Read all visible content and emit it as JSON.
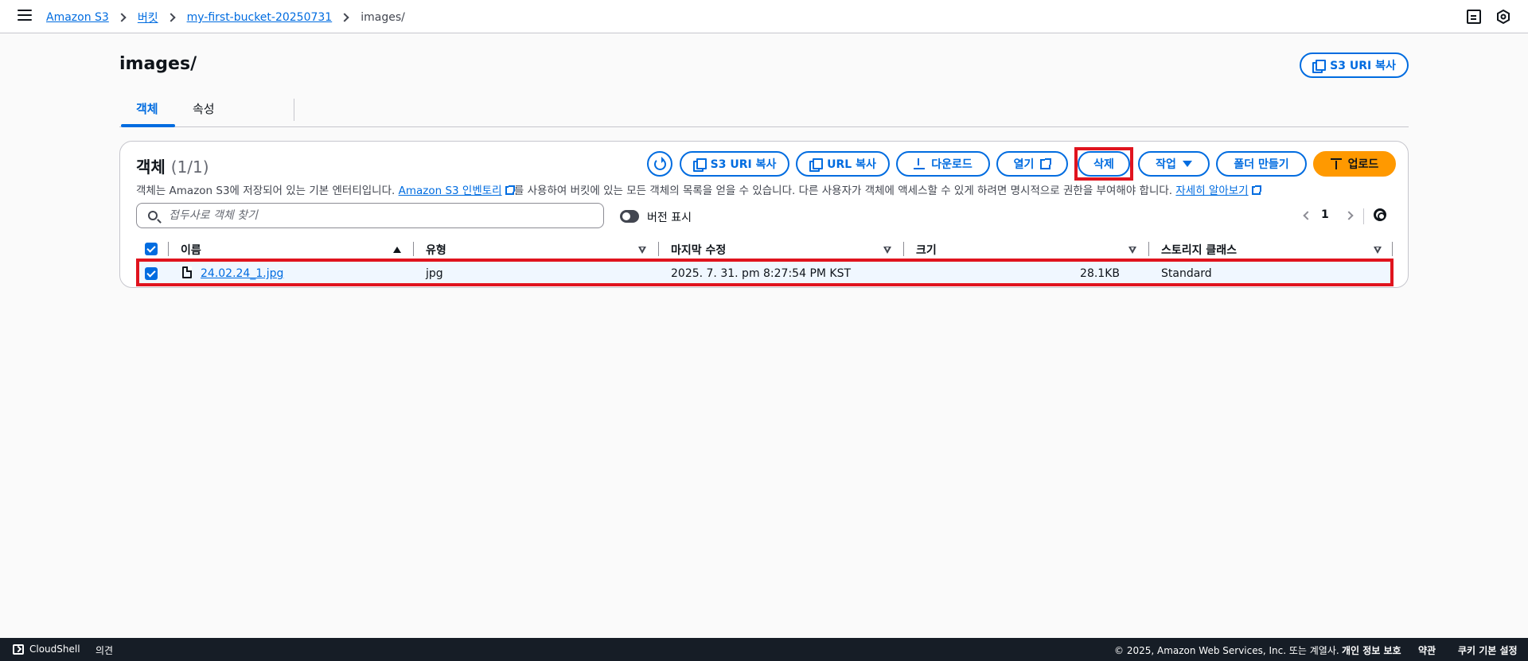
{
  "breadcrumb": {
    "items": [
      "Amazon S3",
      "버킷",
      "my-first-bucket-20250731"
    ],
    "current": "images/"
  },
  "header": {
    "title": "images/",
    "copy_s3_uri_label": "S3 URI 복사"
  },
  "tabs": [
    {
      "label": "객체",
      "active": true
    },
    {
      "label": "속성",
      "active": false
    }
  ],
  "objects_panel": {
    "title": "객체",
    "count": "(1/1)",
    "description_before": "객체는 Amazon S3에 저장되어 있는 기본 엔터티입니다. ",
    "inventory_link": "Amazon S3 인벤토리",
    "description_after": "를 사용하여 버킷에 있는 모든 객체의 목록을 얻을 수 있습니다. 다른 사용자가 객체에 액세스할 수 있게 하려면 명시적으로 권한을 부여해야 합니다. ",
    "learn_more_link": "자세히 알아보기",
    "actions": {
      "copy_s3_uri": "S3 URI 복사",
      "copy_url": "URL 복사",
      "download": "다운로드",
      "open": "열기",
      "delete": "삭제",
      "actions": "작업",
      "create_folder": "폴더 만들기",
      "upload": "업로드"
    },
    "search_placeholder": "접두사로 객체 찾기",
    "show_versions_label": "버전 표시",
    "page_number": "1",
    "columns": [
      "이름",
      "유형",
      "마지막 수정",
      "크기",
      "스토리지 클래스"
    ],
    "rows": [
      {
        "name": "24.02.24_1.jpg",
        "type": "jpg",
        "last_modified": "2025. 7. 31. pm 8:27:54 PM KST",
        "size": "28.1KB",
        "storage_class": "Standard"
      }
    ]
  },
  "footer": {
    "cloudshell": "CloudShell",
    "feedback": "의견",
    "copyright": "© 2025, Amazon Web Services, Inc. 또는 계열사.",
    "privacy": "개인 정보 보호",
    "terms": "약관",
    "cookie": "쿠키 기본 설정"
  },
  "colors": {
    "accent": "#006ce0",
    "upload_button": "#ff9900",
    "highlight": "#e0141e",
    "footer_bg": "#161d26"
  }
}
